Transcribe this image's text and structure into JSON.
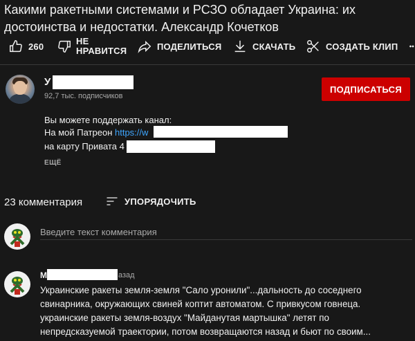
{
  "video": {
    "title": "Какими ракетными системами и РСЗО обладает Украина: их достоинства и недостатки. Александр Кочетков"
  },
  "actions": {
    "like_count": "260",
    "dislike_line1": "НЕ",
    "dislike_line2": "НРАВИТСЯ",
    "share_label": "ПОДЕЛИТЬСЯ",
    "download_label": "СКАЧАТЬ",
    "clip_label": "СОЗДАТЬ КЛИП"
  },
  "channel": {
    "name_visible": "У",
    "subscribers": "92,7 тыс. подписчиков",
    "subscribe_label": "ПОДПИСАТЬСЯ"
  },
  "description": {
    "line1": "Вы можете поддержать канал:",
    "line2_prefix": "На мой Патреон ",
    "line2_link": "https://w",
    "line3_prefix": "на карту Привата 4",
    "more_label": "ЕЩЁ"
  },
  "comments": {
    "count_label": "23 комментария",
    "sort_label": "УПОРЯДОЧИТЬ",
    "input_placeholder": "Введите текст комментария",
    "items": [
      {
        "author_visible": "М",
        "time_suffix": "азад",
        "text_lines": [
          "Украинские ракеты земля-земля \"Сало уронили\"...дальность до соседнего",
          "свинарника, окружающих свиней коптит автоматом. С привкусом говнеца.",
          "украинские ракеты земля-воздух \"Майданутая мартышка\" летят по",
          "непредсказуемой траектории, потом возвращаются назад и бьют по своим..."
        ]
      }
    ]
  },
  "colors": {
    "background": "#181818",
    "subscribe": "#cc0000",
    "link": "#3ea6ff",
    "secondary_text": "#aaaaaa"
  }
}
